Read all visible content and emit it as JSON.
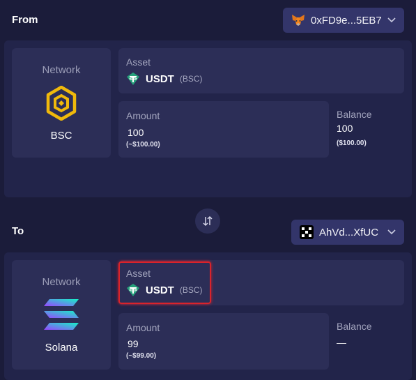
{
  "from": {
    "section_label": "From",
    "wallet": {
      "address": "0xFD9e...5EB7",
      "icon": "metamask-fox-icon"
    },
    "network": {
      "label": "Network",
      "name": "BSC",
      "icon": "bnb-icon"
    },
    "asset": {
      "label": "Asset",
      "symbol": "USDT",
      "chain": "(BSC)",
      "icon": "tether-icon"
    },
    "amount": {
      "label": "Amount",
      "value": "100",
      "usd": "(~$100.00)"
    },
    "balance": {
      "label": "Balance",
      "value": "100",
      "usd": "($100.00)"
    }
  },
  "to": {
    "section_label": "To",
    "wallet": {
      "address": "AhVd...XfUC",
      "icon": "okx-wallet-icon"
    },
    "network": {
      "label": "Network",
      "name": "Solana",
      "icon": "solana-icon"
    },
    "asset": {
      "label": "Asset",
      "symbol": "USDT",
      "chain": "(BSC)",
      "icon": "tether-icon"
    },
    "amount": {
      "label": "Amount",
      "value": "99",
      "usd": "(~$99.00)"
    },
    "balance": {
      "label": "Balance",
      "value": "—"
    }
  },
  "swap": {
    "icon": "swap-direction-icon"
  },
  "colors": {
    "background": "#1b1c3a",
    "panel": "#22244a",
    "card": "#2c2e57",
    "wallet_button": "#33356a",
    "bnb": "#f0b90b",
    "tether": "#26a17b",
    "highlight": "#d9232b"
  }
}
